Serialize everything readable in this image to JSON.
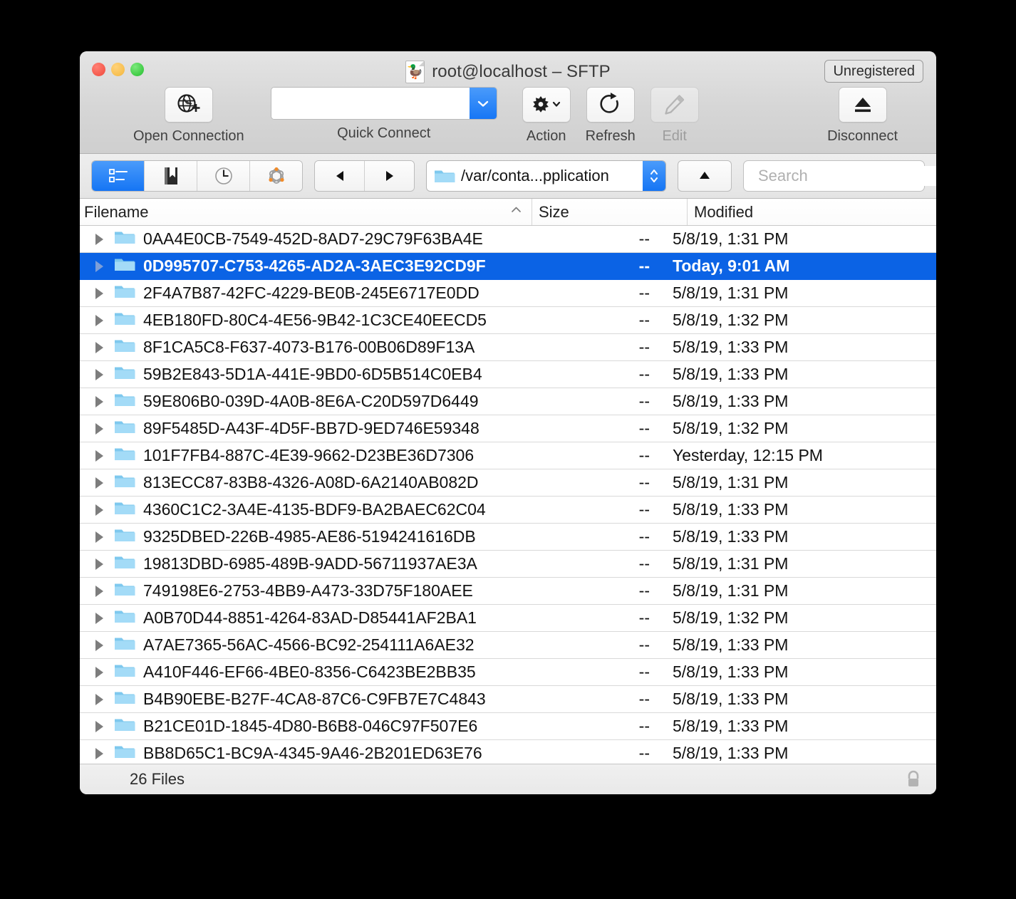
{
  "window": {
    "title": "root@localhost – SFTP",
    "title_icon": "duck-document-icon",
    "registration_badge": "Unregistered"
  },
  "toolbar": {
    "open_connection": {
      "label": "Open Connection",
      "icon": "globe-plus-icon"
    },
    "quick_connect": {
      "label": "Quick Connect",
      "value": "",
      "placeholder": "",
      "dropdown_icon": "chevron-down-icon"
    },
    "action": {
      "label": "Action",
      "icon": "gear-icon"
    },
    "refresh": {
      "label": "Refresh",
      "icon": "refresh-icon"
    },
    "edit": {
      "label": "Edit",
      "icon": "pencil-icon",
      "enabled": false
    },
    "disconnect": {
      "label": "Disconnect",
      "icon": "eject-icon"
    }
  },
  "navbar": {
    "segments": [
      {
        "name": "browser",
        "icon": "list-view-icon",
        "active": true
      },
      {
        "name": "bookmarks",
        "icon": "bookmark-icon",
        "active": false
      },
      {
        "name": "history",
        "icon": "clock-icon",
        "active": false
      },
      {
        "name": "bonjour",
        "icon": "bonjour-icon",
        "active": false
      }
    ],
    "back_icon": "triangle-left-icon",
    "forward_icon": "triangle-right-icon",
    "path": "/var/conta...pplication",
    "path_icon": "folder-icon",
    "path_stepper_icon": "stepper-updown-icon",
    "up_icon": "triangle-up-icon",
    "search": {
      "placeholder": "Search",
      "value": "",
      "icon": "search-icon"
    }
  },
  "table": {
    "columns": [
      {
        "key": "filename",
        "label": "Filename",
        "sort_icon": "chevron-up-icon"
      },
      {
        "key": "size",
        "label": "Size"
      },
      {
        "key": "modified",
        "label": "Modified"
      }
    ],
    "rows": [
      {
        "name": "0AA4E0CB-7549-452D-8AD7-29C79F63BA4E",
        "size": "--",
        "modified": "5/8/19, 1:31 PM",
        "selected": false
      },
      {
        "name": "0D995707-C753-4265-AD2A-3AEC3E92CD9F",
        "size": "--",
        "modified": "Today, 9:01 AM",
        "selected": true
      },
      {
        "name": "2F4A7B87-42FC-4229-BE0B-245E6717E0DD",
        "size": "--",
        "modified": "5/8/19, 1:31 PM",
        "selected": false
      },
      {
        "name": "4EB180FD-80C4-4E56-9B42-1C3CE40EECD5",
        "size": "--",
        "modified": "5/8/19, 1:32 PM",
        "selected": false
      },
      {
        "name": "8F1CA5C8-F637-4073-B176-00B06D89F13A",
        "size": "--",
        "modified": "5/8/19, 1:33 PM",
        "selected": false
      },
      {
        "name": "59B2E843-5D1A-441E-9BD0-6D5B514C0EB4",
        "size": "--",
        "modified": "5/8/19, 1:33 PM",
        "selected": false
      },
      {
        "name": "59E806B0-039D-4A0B-8E6A-C20D597D6449",
        "size": "--",
        "modified": "5/8/19, 1:33 PM",
        "selected": false
      },
      {
        "name": "89F5485D-A43F-4D5F-BB7D-9ED746E59348",
        "size": "--",
        "modified": "5/8/19, 1:32 PM",
        "selected": false
      },
      {
        "name": "101F7FB4-887C-4E39-9662-D23BE36D7306",
        "size": "--",
        "modified": "Yesterday, 12:15 PM",
        "selected": false
      },
      {
        "name": "813ECC87-83B8-4326-A08D-6A2140AB082D",
        "size": "--",
        "modified": "5/8/19, 1:31 PM",
        "selected": false
      },
      {
        "name": "4360C1C2-3A4E-4135-BDF9-BA2BAEC62C04",
        "size": "--",
        "modified": "5/8/19, 1:33 PM",
        "selected": false
      },
      {
        "name": "9325DBED-226B-4985-AE86-5194241616DB",
        "size": "--",
        "modified": "5/8/19, 1:33 PM",
        "selected": false
      },
      {
        "name": "19813DBD-6985-489B-9ADD-56711937AE3A",
        "size": "--",
        "modified": "5/8/19, 1:31 PM",
        "selected": false
      },
      {
        "name": "749198E6-2753-4BB9-A473-33D75F180AEE",
        "size": "--",
        "modified": "5/8/19, 1:31 PM",
        "selected": false
      },
      {
        "name": "A0B70D44-8851-4264-83AD-D85441AF2BA1",
        "size": "--",
        "modified": "5/8/19, 1:32 PM",
        "selected": false
      },
      {
        "name": "A7AE7365-56AC-4566-BC92-254111A6AE32",
        "size": "--",
        "modified": "5/8/19, 1:33 PM",
        "selected": false
      },
      {
        "name": "A410F446-EF66-4BE0-8356-C6423BE2BB35",
        "size": "--",
        "modified": "5/8/19, 1:33 PM",
        "selected": false
      },
      {
        "name": "B4B90EBE-B27F-4CA8-87C6-C9FB7E7C4843",
        "size": "--",
        "modified": "5/8/19, 1:33 PM",
        "selected": false
      },
      {
        "name": "B21CE01D-1845-4D80-B6B8-046C97F507E6",
        "size": "--",
        "modified": "5/8/19, 1:33 PM",
        "selected": false
      },
      {
        "name": "BB8D65C1-BC9A-4345-9A46-2B201ED63E76",
        "size": "--",
        "modified": "5/8/19, 1:33 PM",
        "selected": false
      }
    ]
  },
  "statusbar": {
    "file_count": "26 Files",
    "security_icon": "lock-icon"
  },
  "colors": {
    "selection": "#0b63e5",
    "accent": "#1676f5",
    "folder": "#8dd2f5",
    "window_chrome": "#e4e4e4"
  }
}
